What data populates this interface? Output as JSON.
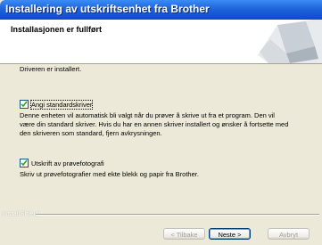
{
  "window": {
    "title": "Installering av utskriftsenhet fra Brother"
  },
  "header": {
    "title": "Installasjonen er fullført"
  },
  "content": {
    "status": "Driveren er installert.",
    "option1": {
      "label": "Angi standardskriver",
      "checked": true,
      "description": [
        "Denne enheten vil automatisk bli valgt når du prøver å skrive ut fra et program. Den vil",
        "være din standard skriver. Hvis du har en annen skriver installert og ønsker å fortsette med",
        "den skriveren som standard, fjern avkrysningen."
      ]
    },
    "option2": {
      "label": "Utskrift av prøvefotografi",
      "checked": true,
      "description": "Skriv ut prøvefotografier med ekte blekk og papir fra Brother."
    }
  },
  "footer": {
    "brand": "InstallShield",
    "back_label": "< Tilbake",
    "next_label": "Neste >",
    "cancel_label": "Avbryt"
  },
  "colors": {
    "titlebar": "#0b4ad0",
    "dialog_bg": "#ece9d8"
  }
}
